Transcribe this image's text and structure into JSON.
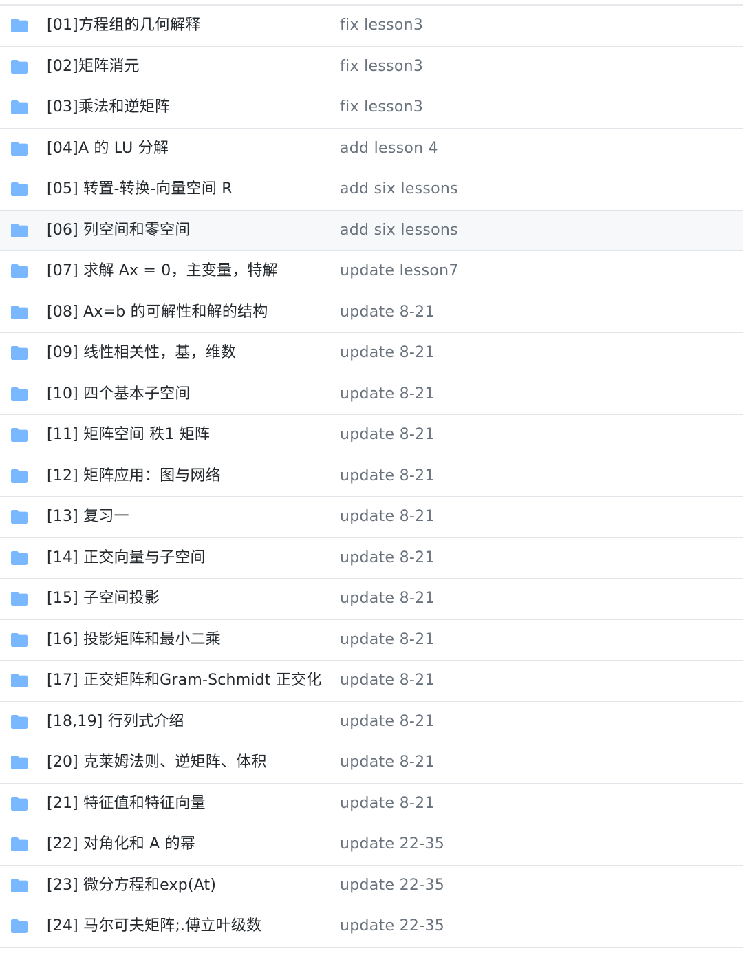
{
  "colors": {
    "folder_icon": "#79b8ff",
    "name_text": "#24292e",
    "message_text": "#6a737d",
    "row_border": "#e1e4e8",
    "hover_row": "#f6f8fa"
  },
  "rows": [
    {
      "icon": "folder-icon",
      "name": "[01]方程组的几何解释",
      "message": "fix lesson3"
    },
    {
      "icon": "folder-icon",
      "name": "[02]矩阵消元",
      "message": "fix lesson3"
    },
    {
      "icon": "folder-icon",
      "name": "[03]乘法和逆矩阵",
      "message": "fix lesson3"
    },
    {
      "icon": "folder-icon",
      "name": "[04]A 的 LU 分解",
      "message": "add lesson 4"
    },
    {
      "icon": "folder-icon",
      "name": "[05] 转置-转换-向量空间 R",
      "message": "add six lessons"
    },
    {
      "icon": "folder-icon",
      "name": "[06] 列空间和零空间",
      "message": "add six lessons",
      "hover": true
    },
    {
      "icon": "folder-icon",
      "name": "[07] 求解 Ax = 0，主变量，特解",
      "message": "update lesson7"
    },
    {
      "icon": "folder-icon",
      "name": "[08] Ax=b 的可解性和解的结构",
      "message": "update 8-21"
    },
    {
      "icon": "folder-icon",
      "name": "[09] 线性相关性，基，维数",
      "message": "update 8-21"
    },
    {
      "icon": "folder-icon",
      "name": "[10] 四个基本子空间",
      "message": "update 8-21"
    },
    {
      "icon": "folder-icon",
      "name": "[11] 矩阵空间 秩1 矩阵",
      "message": "update 8-21"
    },
    {
      "icon": "folder-icon",
      "name": "[12] 矩阵应用：图与网络",
      "message": "update 8-21"
    },
    {
      "icon": "folder-icon",
      "name": "[13] 复习一",
      "message": "update 8-21"
    },
    {
      "icon": "folder-icon",
      "name": "[14] 正交向量与子空间",
      "message": "update 8-21"
    },
    {
      "icon": "folder-icon",
      "name": "[15] 子空间投影",
      "message": "update 8-21"
    },
    {
      "icon": "folder-icon",
      "name": "[16] 投影矩阵和最小二乘",
      "message": "update 8-21"
    },
    {
      "icon": "folder-icon",
      "name": "[17] 正交矩阵和Gram-Schmidt 正交化",
      "message": "update 8-21"
    },
    {
      "icon": "folder-icon",
      "name": "[18,19] 行列式介绍",
      "message": "update 8-21"
    },
    {
      "icon": "folder-icon",
      "name": "[20] 克莱姆法则、逆矩阵、体积",
      "message": "update 8-21"
    },
    {
      "icon": "folder-icon",
      "name": "[21] 特征值和特征向量",
      "message": "update 8-21"
    },
    {
      "icon": "folder-icon",
      "name": "[22] 对角化和 A 的幂",
      "message": "update 22-35"
    },
    {
      "icon": "folder-icon",
      "name": "[23] 微分方程和exp(At)",
      "message": "update 22-35"
    },
    {
      "icon": "folder-icon",
      "name": "[24] 马尔可夫矩阵;.傅立叶级数",
      "message": "update 22-35"
    }
  ]
}
